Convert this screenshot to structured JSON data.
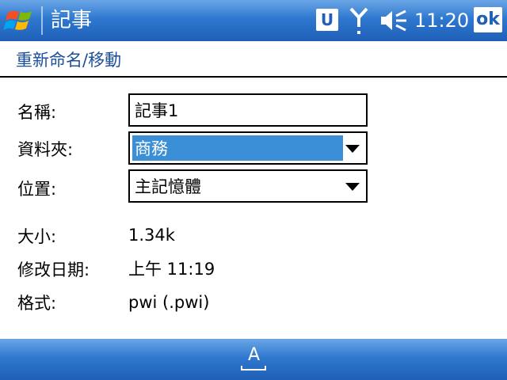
{
  "titlebar": {
    "app_title": "記事",
    "u_badge": "U",
    "clock": "11:20",
    "ok_label": "ok",
    "icons": [
      "windows-start-icon",
      "signal-icon",
      "volume-icon"
    ]
  },
  "header": {
    "title": "重新命名/移動"
  },
  "form": {
    "name_label": "名稱:",
    "name_value": "記事1",
    "folder_label": "資料夾:",
    "folder_value": "商務",
    "location_label": "位置:",
    "location_value": "主記憶體"
  },
  "info": {
    "size_label": "大小:",
    "size_value": "1.34k",
    "modified_label": "修改日期:",
    "modified_value": "上午 11:19",
    "format_label": "格式:",
    "format_value": "pwi (.pwi)"
  },
  "bottombar": {
    "sip_letter": "A"
  },
  "colors": {
    "titlebar": "#2f78cf",
    "header_text": "#1c4f9c",
    "selection": "#3a8fd6"
  }
}
